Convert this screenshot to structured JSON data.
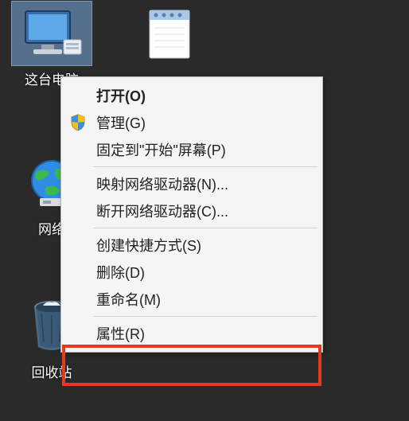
{
  "desktop": {
    "icons": {
      "pc": {
        "label": "这台电脑"
      },
      "textfile": {
        "label": ""
      },
      "network": {
        "label": "网络"
      },
      "recycle": {
        "label": "回收站"
      }
    }
  },
  "context_menu": {
    "open": "打开(O)",
    "manage": "管理(G)",
    "pin_start": "固定到\"开始\"屏幕(P)",
    "map_drive": "映射网络驱动器(N)...",
    "disconnect_drive": "断开网络驱动器(C)...",
    "create_shortcut": "创建快捷方式(S)",
    "delete": "删除(D)",
    "rename": "重命名(M)",
    "properties": "属性(R)"
  }
}
